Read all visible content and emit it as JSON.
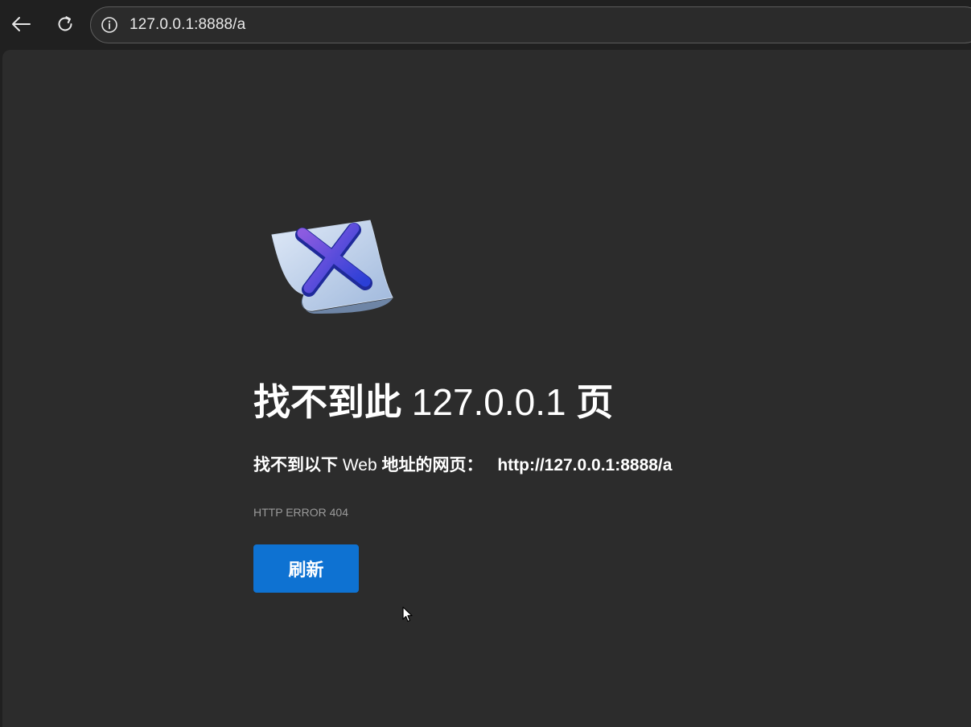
{
  "browser": {
    "url": "127.0.0.1:8888/a",
    "icons": {
      "back": "back-arrow-icon",
      "reload": "reload-icon",
      "site_info": "info-icon"
    }
  },
  "page": {
    "title_prefix": "找不到此",
    "title_host": "127.0.0.1",
    "title_suffix": "页",
    "subtitle_prefix": "找不到以下",
    "subtitle_web": "Web",
    "subtitle_suffix": "地址的网页：",
    "subtitle_url": "http://127.0.0.1:8888/a",
    "error_code": "HTTP ERROR 404",
    "refresh_label": "刷新"
  },
  "colors": {
    "background": "#2c2c2c",
    "toolbar": "#202020",
    "accent_button": "#0e72d2",
    "text_primary": "#ffffff",
    "text_secondary": "#9a9a9a"
  }
}
